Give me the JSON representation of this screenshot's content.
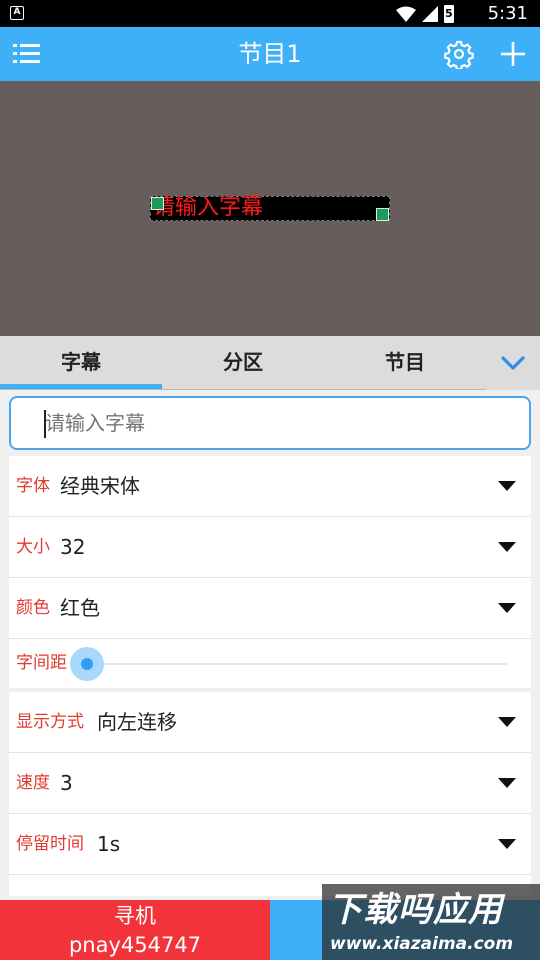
{
  "status_bar": {
    "app_badge": "A",
    "time": "5:31",
    "battery_label": "5"
  },
  "app_bar": {
    "title": "节目1"
  },
  "preview": {
    "caption_text": "请输入字幕"
  },
  "tabs": [
    {
      "label": "字幕",
      "selected": true
    },
    {
      "label": "分区",
      "selected": false
    },
    {
      "label": "节目",
      "selected": false
    }
  ],
  "caption_input": {
    "placeholder": "请输入字幕",
    "value": ""
  },
  "settings": {
    "font": {
      "label": "字体",
      "value": "经典宋体"
    },
    "size": {
      "label": "大小",
      "value": "32"
    },
    "color": {
      "label": "颜色",
      "value": "红色"
    },
    "spacing": {
      "label": "字间距",
      "level": 0
    },
    "display_mode": {
      "label": "显示方式",
      "value": "向左连移"
    },
    "speed": {
      "label": "速度",
      "value": "3"
    },
    "dwell_time": {
      "label": "停留时间",
      "value": "1s"
    }
  },
  "bottom_bar": {
    "find_label": "寻机",
    "device_id": "pnay454747"
  },
  "watermark": {
    "brand": "下载吗应用",
    "url": "www.xiazaima.com"
  },
  "colors": {
    "primary": "#3db0f7",
    "accent_red": "#f2343a",
    "label_red": "#e23a2e",
    "preview_bg": "#665d5c"
  }
}
